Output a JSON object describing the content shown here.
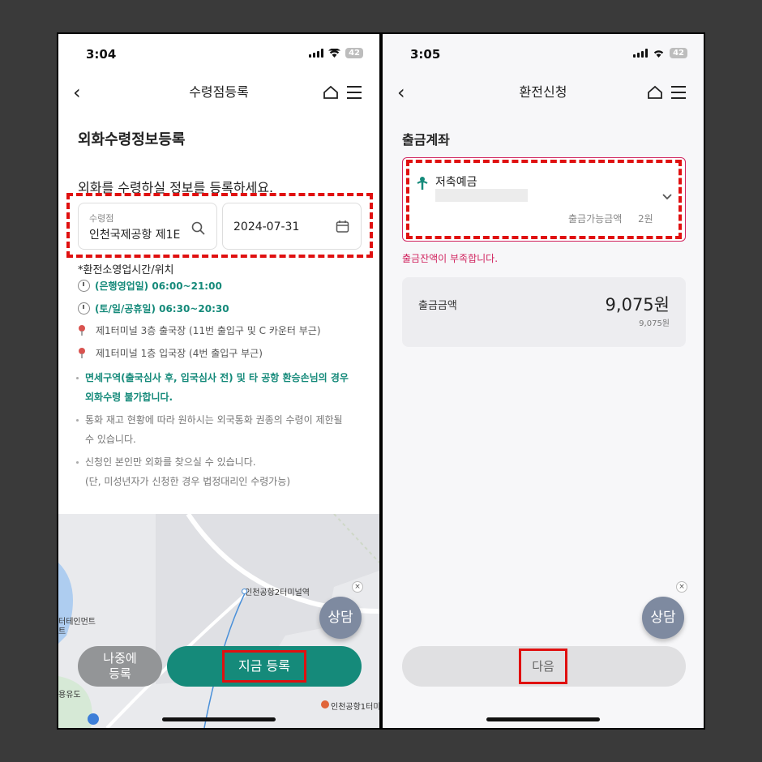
{
  "left": {
    "status": {
      "time": "3:04",
      "battery": "42"
    },
    "header": {
      "title": "수령점등록"
    },
    "section_title": "외화수령정보등록",
    "description": "외화를 수령하실 정보를 등록하세요.",
    "pickup_field": {
      "label": "수령점",
      "value": "인천국제공항 제1E"
    },
    "date_field": {
      "value": "2024-07-31"
    },
    "hours_title": "*환전소영업시간/위치",
    "hours": [
      {
        "text": "(은행영업일) 06:00~21:00"
      },
      {
        "text": "(토/일/공휴일) 06:30~20:30"
      }
    ],
    "locations": [
      {
        "text": "제1터미널 3층 출국장 (11번 출입구 및 C 카운터 부근)"
      },
      {
        "text": "제1터미널 1층 입국장 (4번 출입구 부근)"
      }
    ],
    "notices": [
      {
        "line1": "면세구역(출국심사 후, 입국심사 전) 및 타 공항 환승손님의 경우",
        "line2": "외화수령 불가합니다."
      },
      {
        "line1": "통화 재고 현황에 따라 원하시는 외국통화 권종의 수령이 제한될",
        "line2": "수 있습니다."
      },
      {
        "line1": "신청인 본인만 외화를 찾으실 수 있습니다.",
        "line2": "(단, 미성년자가 신청한 경우 법정대리인 수령가능)"
      }
    ],
    "map_labels": {
      "station": "인천공항2터미널역",
      "place1": "터테인먼트",
      "place1b": "트",
      "place2": "용유도",
      "place3": "인천공항1터미"
    },
    "buttons": {
      "later": "나중에 등록",
      "later_l1": "나중에",
      "later_l2": "등록",
      "now": "지금 등록"
    },
    "chat": {
      "label": "상담",
      "close": "×"
    }
  },
  "right": {
    "status": {
      "time": "3:05",
      "battery": "42"
    },
    "header": {
      "title": "환전신청"
    },
    "section_title": "출금계좌",
    "account": {
      "bank": "저축예금",
      "available_label": "출금가능금액",
      "available_value": "2원"
    },
    "error": "출금잔액이 부족합니다.",
    "amount": {
      "label": "출금금액",
      "value": "9,075원",
      "sub": "9,075원"
    },
    "buttons": {
      "next": "다음"
    },
    "chat": {
      "label": "상담",
      "close": "×"
    }
  },
  "colors": {
    "accent": "#158a7a",
    "error": "#d1245f",
    "highlight": "#e01010"
  }
}
